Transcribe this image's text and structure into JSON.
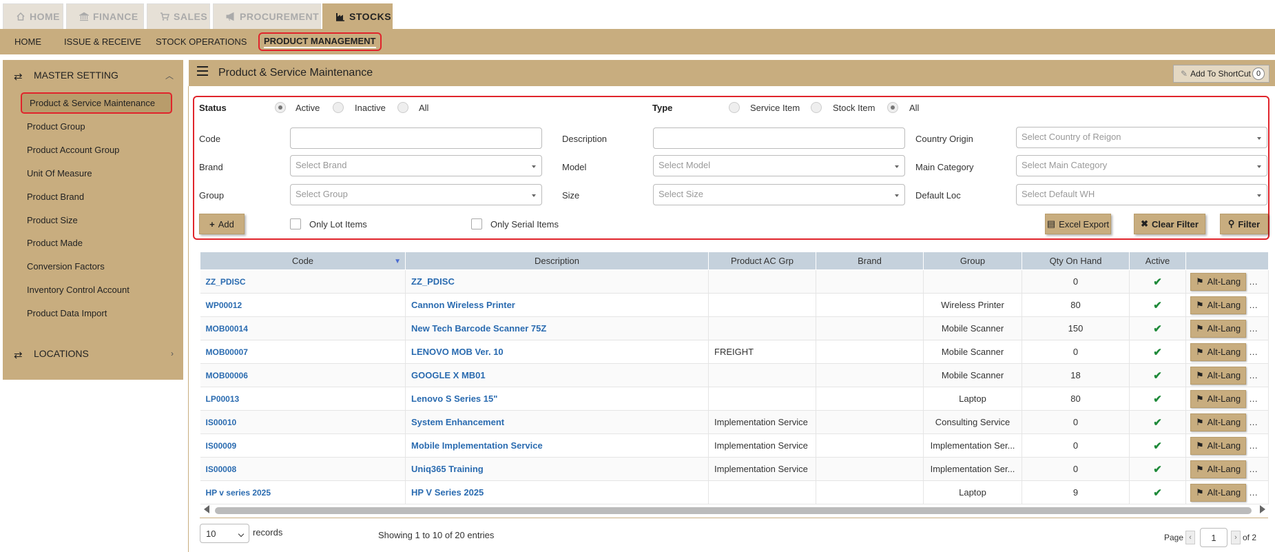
{
  "top_tabs": [
    {
      "label": "HOME",
      "icon": "home-icon"
    },
    {
      "label": "FINANCE",
      "icon": "bank-icon"
    },
    {
      "label": "SALES",
      "icon": "cart-icon"
    },
    {
      "label": "PROCUREMENT",
      "icon": "bullhorn-icon"
    },
    {
      "label": "STOCKS",
      "icon": "factory-icon",
      "active": true
    }
  ],
  "sub_nav": [
    "HOME",
    "ISSUE & RECEIVE",
    "STOCK OPERATIONS",
    "PRODUCT MANAGEMENT"
  ],
  "sidebar": {
    "master_setting": "MASTER SETTING",
    "items": [
      "Product & Service Maintenance",
      "Product Group",
      "Product Account Group",
      "Unit Of Measure",
      "Product Brand",
      "Product Size",
      "Product Made",
      "Conversion Factors",
      "Inventory Control Account",
      "Product Data Import"
    ],
    "locations": "LOCATIONS"
  },
  "main": {
    "title": "Product & Service Maintenance",
    "shortcut_label": "Add To ShortCut",
    "shortcut_count": "0"
  },
  "filters": {
    "status_label": "Status",
    "status_options": [
      "Active",
      "Inactive",
      "All"
    ],
    "type_label": "Type",
    "type_options": [
      "Service Item",
      "Stock Item",
      "All"
    ],
    "code_label": "Code",
    "description_label": "Description",
    "country_label": "Country Origin",
    "country_placeholder": "Select Country of Reigon",
    "brand_label": "Brand",
    "brand_placeholder": "Select Brand",
    "model_label": "Model",
    "model_placeholder": "Select Model",
    "main_category_label": "Main Category",
    "main_category_placeholder": "Select Main Category",
    "group_label": "Group",
    "group_placeholder": "Select Group",
    "size_label": "Size",
    "size_placeholder": "Select Size",
    "default_loc_label": "Default Loc",
    "default_loc_placeholder": "Select Default WH",
    "add_label": "Add",
    "only_lot_label": "Only Lot Items",
    "only_serial_label": "Only Serial Items",
    "excel_label": "Excel Export",
    "clear_label": "Clear Filter",
    "filter_label": "Filter"
  },
  "table": {
    "headers": [
      "Code",
      "Description",
      "Product AC Grp",
      "Brand",
      "Group",
      "Qty On Hand",
      "Active",
      ""
    ],
    "alt_lang_label": "Alt-Lang",
    "rows": [
      {
        "code": "ZZ_PDISC",
        "desc": "ZZ_PDISC",
        "acgrp": "",
        "brand": "",
        "group": "",
        "qty": "0"
      },
      {
        "code": "WP00012",
        "desc": "Cannon Wireless Printer",
        "acgrp": "",
        "brand": "",
        "group": "Wireless Printer",
        "qty": "80"
      },
      {
        "code": "MOB00014",
        "desc": "New Tech Barcode Scanner 75Z",
        "acgrp": "",
        "brand": "",
        "group": "Mobile Scanner",
        "qty": "150"
      },
      {
        "code": "MOB00007",
        "desc": "LENOVO MOB Ver. 10",
        "acgrp": "FREIGHT",
        "brand": "",
        "group": "Mobile Scanner",
        "qty": "0"
      },
      {
        "code": "MOB00006",
        "desc": "GOOGLE X MB01",
        "acgrp": "",
        "brand": "",
        "group": "Mobile Scanner",
        "qty": "18"
      },
      {
        "code": "LP00013",
        "desc": "Lenovo S Series 15\"",
        "acgrp": "",
        "brand": "",
        "group": "Laptop",
        "qty": "80"
      },
      {
        "code": "IS00010",
        "desc": "System Enhancement",
        "acgrp": "Implementation Service",
        "brand": "",
        "group": "Consulting Service",
        "qty": "0"
      },
      {
        "code": "IS00009",
        "desc": "Mobile Implementation Service",
        "acgrp": "Implementation Service",
        "brand": "",
        "group": "Implementation Ser...",
        "qty": "0"
      },
      {
        "code": "IS00008",
        "desc": "Uniq365 Training",
        "acgrp": "Implementation Service",
        "brand": "",
        "group": "Implementation Ser...",
        "qty": "0"
      },
      {
        "code": "HP v series 2025",
        "desc": "HP V Series 2025",
        "acgrp": "",
        "brand": "",
        "group": "Laptop",
        "qty": "9"
      }
    ]
  },
  "pager": {
    "page_size": "10",
    "records_label": "records",
    "showing": "Showing 1 to 10 of 20 entries",
    "page_label": "Page",
    "current_page": "1",
    "of_label": "of 2"
  },
  "colors": {
    "accent": "#c8ad7f",
    "highlight": "#e0242b",
    "link": "#2a6bb0",
    "active_check": "#1f8a3a"
  }
}
